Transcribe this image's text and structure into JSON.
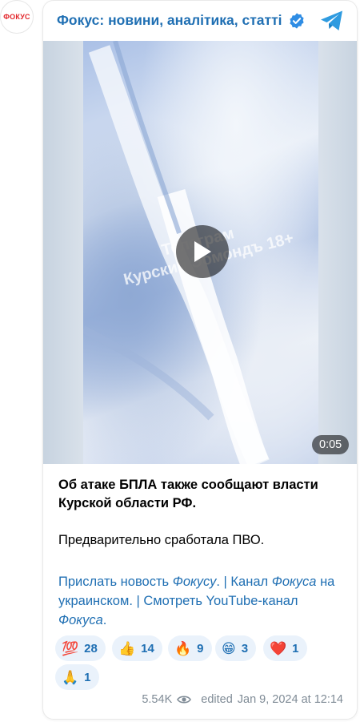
{
  "channel": {
    "avatar_text": "ФОКУС",
    "title": "Фокус: новини, аналітика, статті",
    "verified_icon": "verified-check-icon",
    "telegram_icon": "telegram-plane-icon"
  },
  "video": {
    "duration": "0:05",
    "watermark_line1": "Телеграм",
    "watermark_line2": "Курский Эомондъ 18+"
  },
  "message": {
    "bold_text": "Об атаке БПЛА также сообщают власти Курской области РФ.",
    "paragraph": "Предварительно сработала ПВО.",
    "links": {
      "send_news_prefix": "Прислать новость ",
      "send_news_italic": "Фокусу",
      "sep1": ". | ",
      "channel_prefix": "Канал ",
      "channel_italic": "Фокуса",
      "channel_suffix": " на украинском",
      "sep2": ". | ",
      "youtube_prefix": "Смотреть YouTube-канал ",
      "youtube_italic": "Фокуса",
      "youtube_suffix": "."
    }
  },
  "reactions": [
    {
      "emoji": "💯",
      "count": "28"
    },
    {
      "emoji": "👍",
      "count": "14"
    },
    {
      "emoji": "🔥",
      "count": "9"
    },
    {
      "emoji": "😁",
      "count": "3"
    },
    {
      "emoji": "❤️",
      "count": "1"
    },
    {
      "emoji": "🙏",
      "count": "1"
    }
  ],
  "footer": {
    "views": "5.54K",
    "edited_label": "edited",
    "date": "Jan 9, 2024 at 12:14"
  },
  "colors": {
    "accent": "#1f6fb3",
    "reaction_bg": "#eaf2fb",
    "meta": "#7f8b96",
    "brand_red": "#e2262a"
  }
}
